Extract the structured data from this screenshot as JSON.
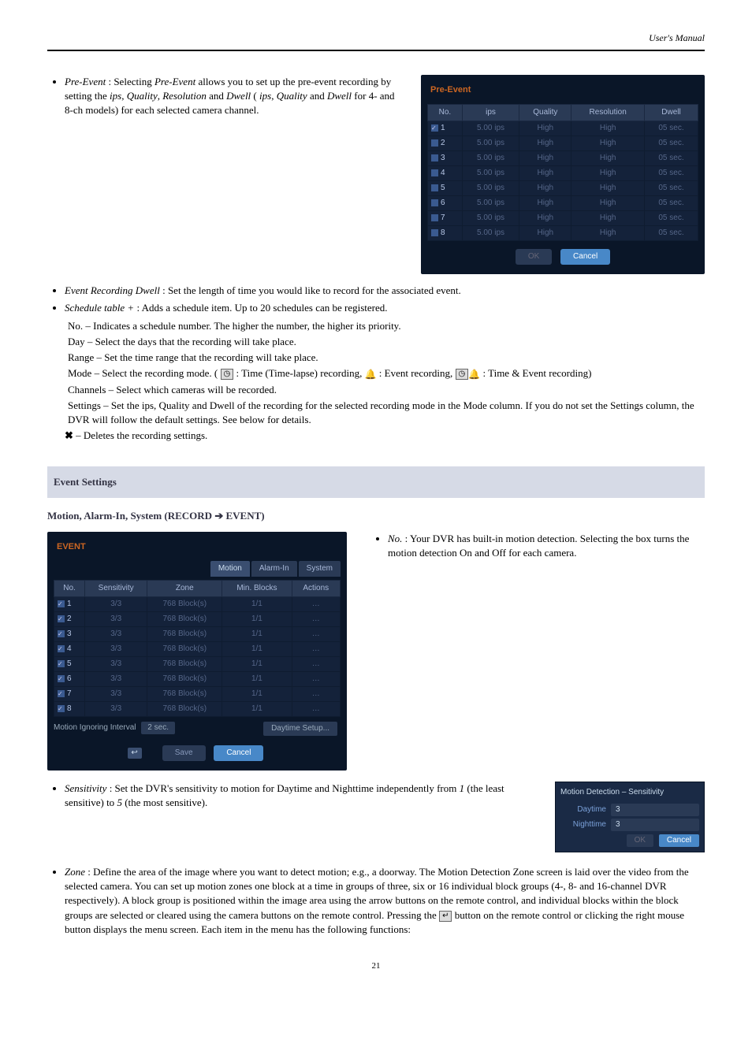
{
  "header": {
    "title": "User's Manual"
  },
  "footer": {
    "page": "21"
  },
  "preevent": {
    "bullet_label": "Pre-Event",
    "bullet_text_1": ": Selecting ",
    "bullet_btn": "Pre-Event",
    "bullet_text_2": " allows you to set up the pre-event recording by setting the",
    "bullet_ips": "ips",
    "bullet_comma1": ", ",
    "bullet_quality": "Quality",
    "bullet_comma2": ", ",
    "bullet_resolution": "Resolution",
    "bullet_and1": " and ",
    "bullet_dwell": "Dwell",
    "bullet_paren_open": " (",
    "bullet_ips2": "ips",
    "bullet_comma3": ", ",
    "bullet_quality2": "Quality",
    "bullet_and2": " and ",
    "bullet_dwell2": "Dwell",
    "bullet_text_3": " for 4- and 8-ch models) for each selected camera channel.",
    "panel_title": "Pre-Event",
    "cols": [
      "No.",
      "ips",
      "Quality",
      "Resolution",
      "Dwell"
    ],
    "rows": [
      {
        "n": "1",
        "on": true,
        "ips": "5.00 ips",
        "q": "High",
        "r": "High",
        "d": "05 sec."
      },
      {
        "n": "2",
        "on": false,
        "ips": "5.00 ips",
        "q": "High",
        "r": "High",
        "d": "05 sec."
      },
      {
        "n": "3",
        "on": false,
        "ips": "5.00 ips",
        "q": "High",
        "r": "High",
        "d": "05 sec."
      },
      {
        "n": "4",
        "on": false,
        "ips": "5.00 ips",
        "q": "High",
        "r": "High",
        "d": "05 sec."
      },
      {
        "n": "5",
        "on": false,
        "ips": "5.00 ips",
        "q": "High",
        "r": "High",
        "d": "05 sec."
      },
      {
        "n": "6",
        "on": false,
        "ips": "5.00 ips",
        "q": "High",
        "r": "High",
        "d": "05 sec."
      },
      {
        "n": "7",
        "on": false,
        "ips": "5.00 ips",
        "q": "High",
        "r": "High",
        "d": "05 sec."
      },
      {
        "n": "8",
        "on": false,
        "ips": "5.00 ips",
        "q": "High",
        "r": "High",
        "d": "05 sec."
      }
    ],
    "ok": "OK",
    "cancel": "Cancel"
  },
  "bullets_after_preevent": {
    "dwell_label": "Event Recording Dwell",
    "dwell_text": ": Set the length of time you would like to record for the associated event.",
    "schedadd_label": "Schedule table +",
    "schedadd_text": ": Adds a schedule item.  Up to 20 schedules can be registered.",
    "dash_no": "No. – Indicates a schedule number.  The higher the number, the higher its priority.",
    "dash_day": "Day – Select the days that the recording will take place.",
    "dash_range": "Range – Set the time range that the recording will take place.",
    "dash_mode_pre": "Mode – Select the recording mode. (",
    "dash_mode_time": ": Time (Time-lapse) recording, ",
    "dash_mode_event": ": Event recording, ",
    "dash_mode_both": ": Time & Event recording)",
    "dash_channels": "Channels – Select which cameras will be recorded.",
    "dash_settings": "Settings – Set the ips, Quality and Dwell of the recording for the selected recording mode in the Mode column.  If you do not set the Settings column, the DVR will follow the default settings.  See below for details.",
    "delete_text": " – Deletes the recording settings."
  },
  "section_event": {
    "heading": "Event Settings",
    "arrow_line_pre": "Motion, Alarm-In, System (RECORD ",
    "arrow_line_post": " EVENT)"
  },
  "event_panel": {
    "title": "EVENT",
    "tabs": [
      "Motion",
      "Alarm-In",
      "System"
    ],
    "active_tab": 0,
    "cols": [
      "No.",
      "Sensitivity",
      "Zone",
      "Min. Blocks",
      "Actions"
    ],
    "rows": [
      {
        "n": "1",
        "on": true,
        "s": "3/3",
        "z": "768 Block(s)",
        "m": "1/1",
        "a": "…"
      },
      {
        "n": "2",
        "on": true,
        "s": "3/3",
        "z": "768 Block(s)",
        "m": "1/1",
        "a": "…"
      },
      {
        "n": "3",
        "on": true,
        "s": "3/3",
        "z": "768 Block(s)",
        "m": "1/1",
        "a": "…"
      },
      {
        "n": "4",
        "on": true,
        "s": "3/3",
        "z": "768 Block(s)",
        "m": "1/1",
        "a": "…"
      },
      {
        "n": "5",
        "on": true,
        "s": "3/3",
        "z": "768 Block(s)",
        "m": "1/1",
        "a": "…"
      },
      {
        "n": "6",
        "on": true,
        "s": "3/3",
        "z": "768 Block(s)",
        "m": "1/1",
        "a": "…"
      },
      {
        "n": "7",
        "on": true,
        "s": "3/3",
        "z": "768 Block(s)",
        "m": "1/1",
        "a": "…"
      },
      {
        "n": "8",
        "on": true,
        "s": "3/3",
        "z": "768 Block(s)",
        "m": "1/1",
        "a": "…"
      }
    ],
    "ignoring_label": "Motion Ignoring Interval",
    "ignoring_val": "2 sec.",
    "daytime_setup": "Daytime Setup...",
    "save": "Save",
    "cancel": "Cancel"
  },
  "event_bullets": {
    "no_label": "No.",
    "no_text": ": Your DVR has built-in motion detection.  Selecting the box turns the motion detection On and Off for each camera.",
    "sens_label": "Sensitivity",
    "sens_text_1": ": Set the DVR's sensitivity to motion for Daytime and Nighttime independently from ",
    "sens_val_low": "1",
    "sens_text_2": " (the least sensitive) to ",
    "sens_val_high": "5",
    "sens_text_3": " (the most sensitive).",
    "zone_label": "Zone",
    "zone_text": ": Define the area of the image where you want to detect motion; e.g., a doorway.  The Motion Detection Zone screen is laid over the video from the selected camera.  You can set up motion zones one block at a time in groups of three, six or 16 individual block groups (4-, 8- and 16-channel DVR respectively).  A block group is positioned within the image area using the arrow buttons on the remote control, and individual blocks within the block groups are selected or cleared using the camera buttons on the remote control.  Pressing the ",
    "zone_text_2": " button on the remote control or clicking the right mouse button displays the menu screen.  Each item in the menu has the following functions:"
  },
  "sens_dialog": {
    "title": "Motion Detection – Sensitivity",
    "daytime_label": "Daytime",
    "daytime_val": "3",
    "nighttime_label": "Nighttime",
    "nighttime_val": "3",
    "ok": "OK",
    "cancel": "Cancel"
  }
}
